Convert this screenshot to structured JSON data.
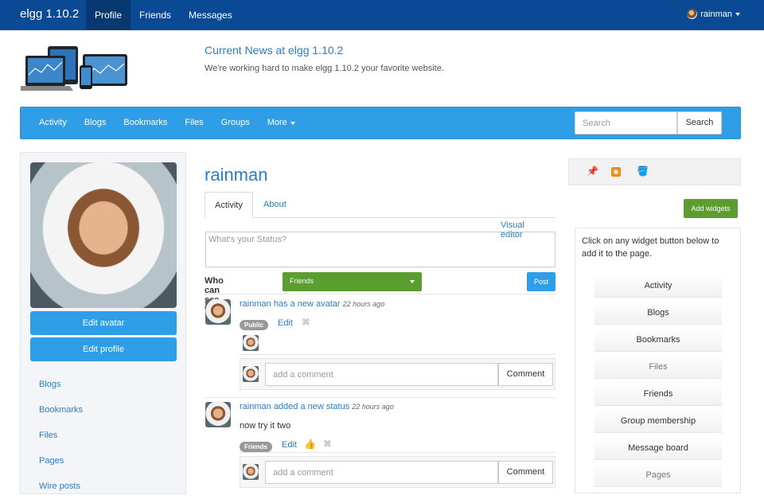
{
  "topbar": {
    "brand": "elgg 1.10.2",
    "nav": [
      "Profile",
      "Friends",
      "Messages"
    ],
    "user": "rainman"
  },
  "header": {
    "news_title": "Current News at elgg 1.10.2",
    "news_text": "We're working hard to make elgg 1.10.2 your favorite website."
  },
  "navbar": {
    "items": [
      "Activity",
      "Blogs",
      "Bookmarks",
      "Files",
      "Groups",
      "More"
    ],
    "search_placeholder": "Search",
    "search_button": "Search"
  },
  "left": {
    "edit_avatar": "Edit avatar",
    "edit_profile": "Edit profile",
    "links": [
      "Blogs",
      "Bookmarks",
      "Files",
      "Pages",
      "Wire posts"
    ]
  },
  "main": {
    "title": "rainman",
    "tabs": [
      "Activity",
      "About"
    ],
    "visual_editor": "Visual editor",
    "status_placeholder": "What's your Status?",
    "who_can_see": "Who can see this:",
    "access_value": "Friends",
    "post_label": "Post",
    "feed": [
      {
        "user": "rainman",
        "action": "has a new avatar",
        "time": "22 hours ago",
        "badge": "Public",
        "edit": "Edit",
        "comment_placeholder": "add a comment",
        "comment_button": "Comment"
      },
      {
        "user": "rainman",
        "action": "added a new status",
        "time": "22 hours ago",
        "text": "now try it two",
        "badge": "Friends",
        "edit": "Edit",
        "comment_placeholder": "add a comment",
        "comment_button": "Comment"
      }
    ]
  },
  "right": {
    "icons": [
      "pushpin-icon",
      "rss-icon",
      "paint-bucket-icon"
    ],
    "add_widgets": "Add widgets",
    "intro": "Click on any widget button below to add it to the page.",
    "widgets": [
      "Activity",
      "Blogs",
      "Bookmarks",
      "Files",
      "Friends",
      "Group membership",
      "Message board",
      "Pages"
    ]
  },
  "colors": {
    "topbar": "#0a4a94",
    "accent": "#2f9ee6",
    "green": "#5b9d2e",
    "link": "#2a7ec4"
  }
}
